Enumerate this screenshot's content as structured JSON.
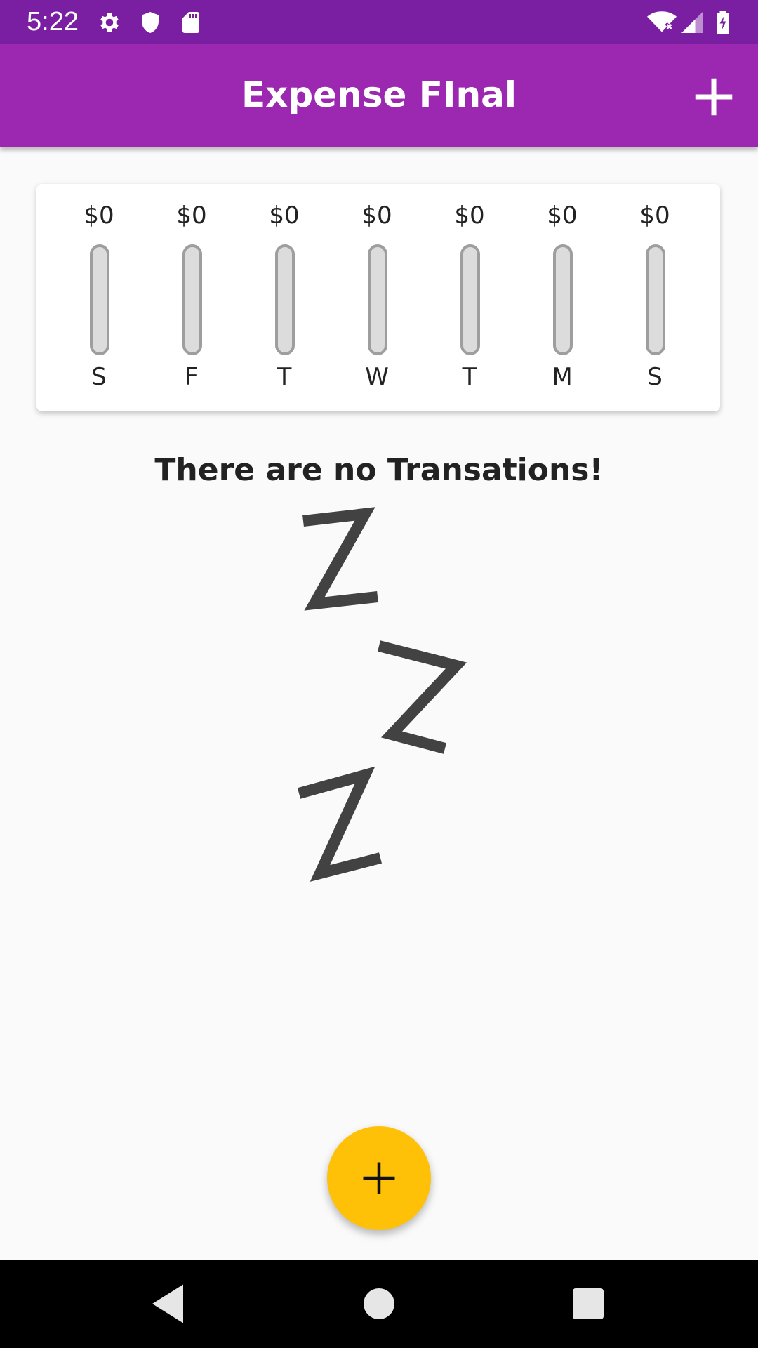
{
  "status_bar": {
    "time": "5:22",
    "icons_left": [
      "settings-icon",
      "shield-icon",
      "sd-card-icon"
    ],
    "icons_right": [
      "wifi-icon",
      "signal-icon",
      "battery-icon"
    ]
  },
  "app_bar": {
    "title": "Expense FInal",
    "action_icon": "plus-icon"
  },
  "chart": {
    "bars": [
      {
        "amount": "$0",
        "day": "S",
        "fill": 0
      },
      {
        "amount": "$0",
        "day": "F",
        "fill": 0
      },
      {
        "amount": "$0",
        "day": "T",
        "fill": 0
      },
      {
        "amount": "$0",
        "day": "W",
        "fill": 0
      },
      {
        "amount": "$0",
        "day": "T",
        "fill": 0
      },
      {
        "amount": "$0",
        "day": "M",
        "fill": 0
      },
      {
        "amount": "$0",
        "day": "S",
        "fill": 0
      }
    ],
    "colors": {
      "track": "#dcdcdc",
      "track_border": "#9e9e9e",
      "fill": "#9c27b0"
    }
  },
  "empty_state": {
    "message": "There are no Transations!",
    "image_icon": "sleeping-zzz-icon"
  },
  "fab": {
    "icon": "plus-icon"
  },
  "colors": {
    "status_bar": "#7b1fa2",
    "primary": "#9c27b0",
    "accent": "#ffc107",
    "background": "#fafafa"
  },
  "nav_bar": {
    "buttons": [
      "back-icon",
      "home-icon",
      "recents-icon"
    ]
  }
}
